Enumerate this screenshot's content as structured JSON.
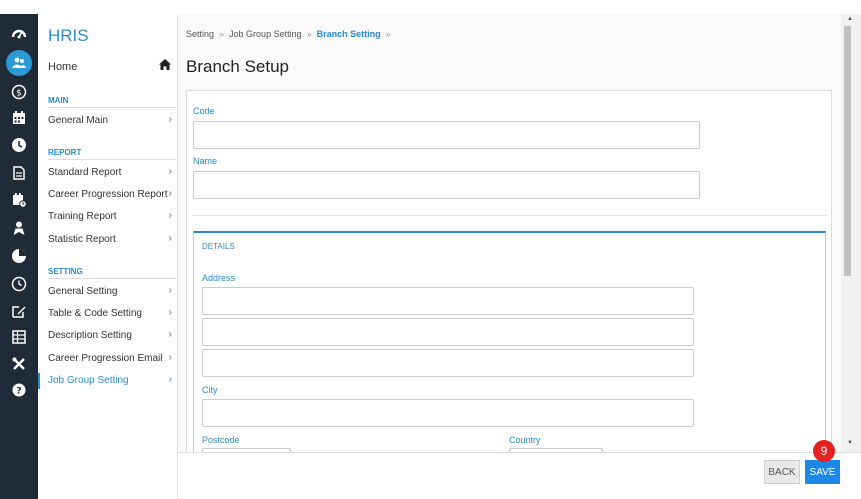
{
  "rail_icons": [
    "dashboard-icon",
    "people-icon",
    "payroll-icon",
    "calendar-icon",
    "clock-icon",
    "document-icon",
    "schedule-icon",
    "user-award-icon",
    "chart-pie-icon",
    "timer-icon",
    "edit-icon",
    "table-icon",
    "tools-icon",
    "help-icon"
  ],
  "sidebar": {
    "brand": "HRIS",
    "home": "Home",
    "section_main": "MAIN",
    "general_main": "General Main",
    "section_report": "REPORT",
    "standard_report": "Standard Report",
    "career_progression_report": "Career Progression Report",
    "training_report": "Training Report",
    "statistic_report": "Statistic Report",
    "section_setting": "SETTING",
    "general_setting": "General Setting",
    "table_code_setting": "Table & Code Setting",
    "description_setting": "Description Setting",
    "career_progression_email": "Career Progression Email",
    "job_group_setting": "Job Group Setting"
  },
  "breadcrumb": {
    "item1": "Setting",
    "item2": "Job Group Setting",
    "item3": "Branch Setting",
    "sep": "»"
  },
  "page_title": "Branch Setup",
  "form": {
    "code_label": "Code",
    "code_value": "",
    "name_label": "Name",
    "name_value": "",
    "details_title": "DETAILS",
    "address_label": "Address",
    "city_label": "City",
    "postcode_label": "Postcode",
    "country_label": "Country"
  },
  "footer": {
    "back_label": "BACK",
    "save_label": "SAVE",
    "step_badge": "9"
  },
  "colors": {
    "accent": "#2b8ccc",
    "save_button": "#1e88e5",
    "badge": "#e32222",
    "rail": "#1f2b36"
  }
}
